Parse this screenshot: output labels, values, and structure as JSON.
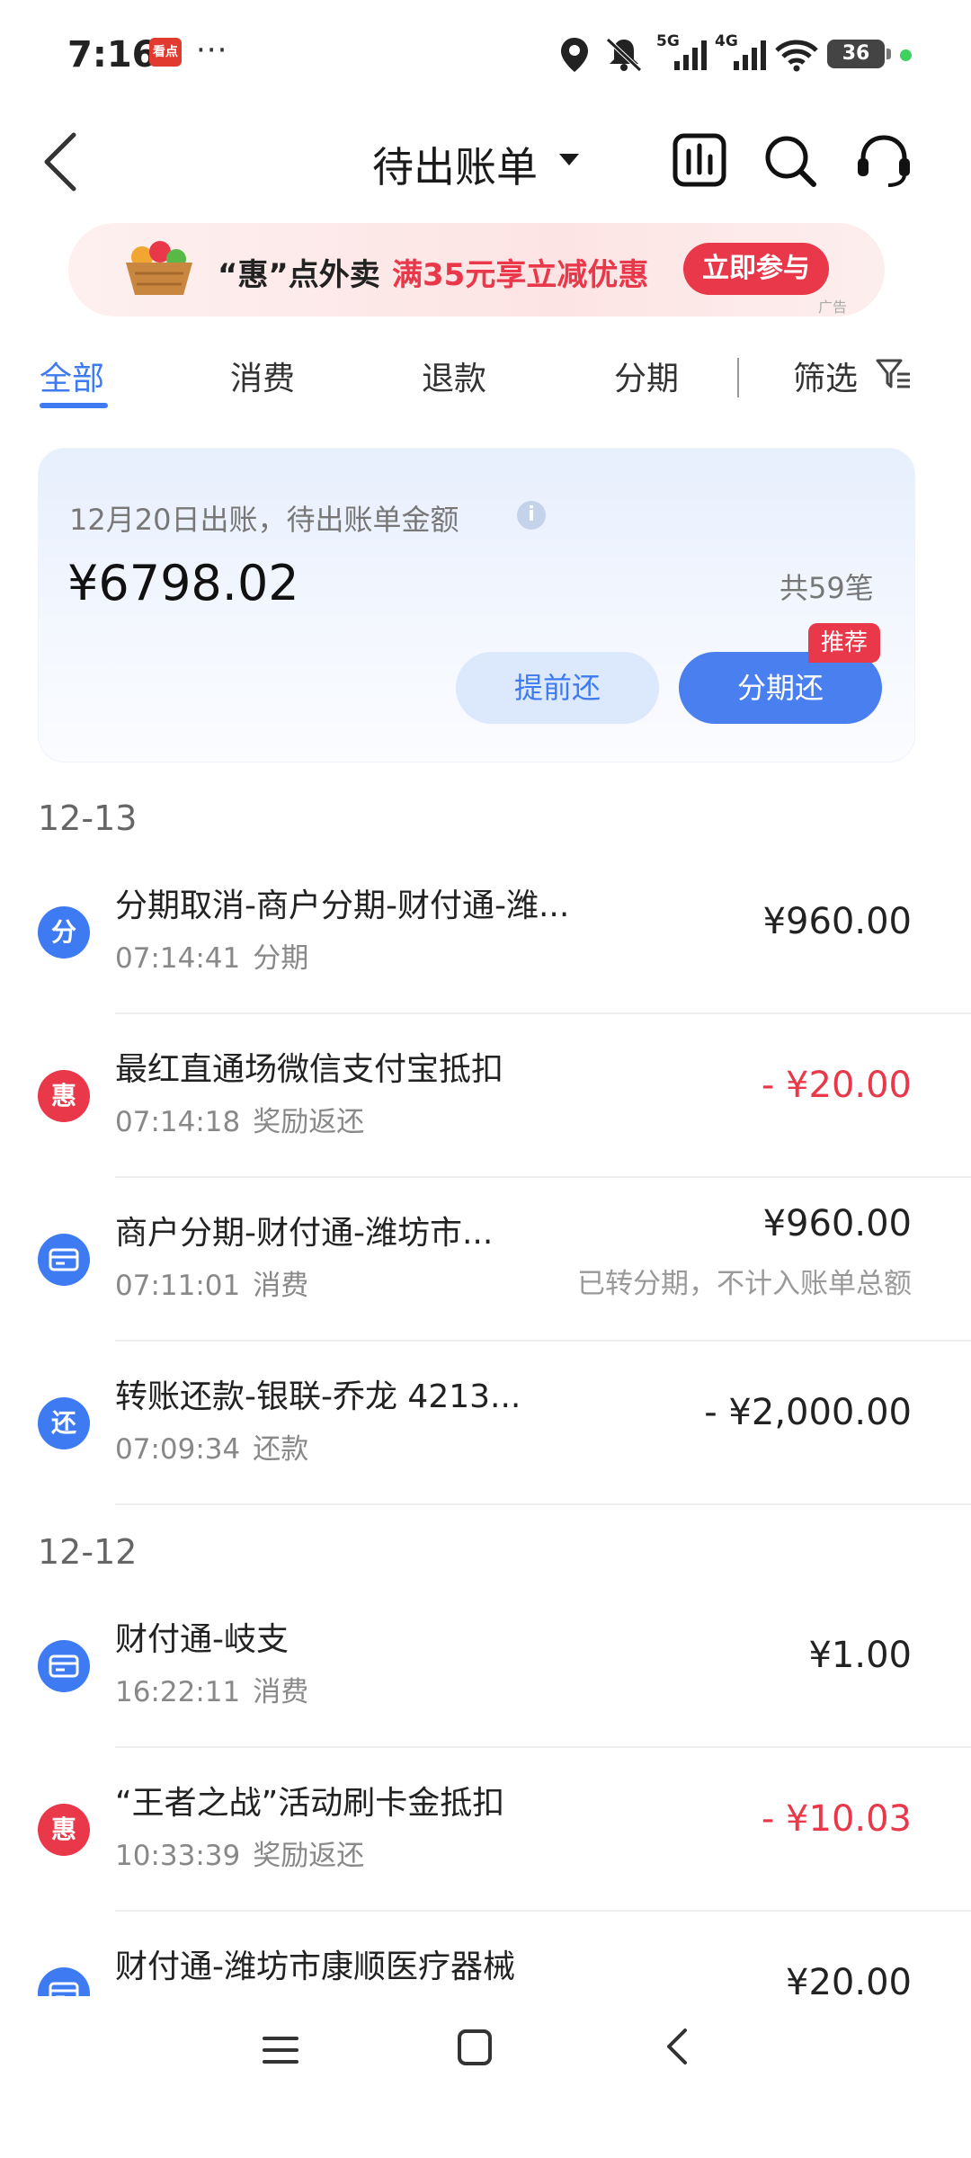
{
  "status_bar": {
    "time": "7:16",
    "app_badge": "看点",
    "more": "···",
    "net_a": "5G",
    "net_b": "4G",
    "battery": "36"
  },
  "header": {
    "title": "待出账单",
    "icons": [
      "back-icon",
      "bar-chart-icon",
      "search-icon",
      "headset-icon"
    ]
  },
  "ad": {
    "text_a": "“惠”点外卖",
    "text_b": "满35元享立减优惠",
    "button": "立即参与",
    "tag": "广告"
  },
  "tabs": [
    {
      "label": "全部",
      "active": true
    },
    {
      "label": "消费",
      "active": false
    },
    {
      "label": "退款",
      "active": false
    },
    {
      "label": "分期",
      "active": false
    }
  ],
  "filter": {
    "label": "筛选"
  },
  "summary": {
    "label": "12月20日出账，待出账单金额",
    "amount": "¥6798.02",
    "count": "共59笔",
    "prepay_button": "提前还",
    "installment_button": "分期还",
    "recommend_badge": "推荐"
  },
  "groups": [
    {
      "date": "12-13",
      "items": [
        {
          "icon_text": "分",
          "icon_color": "#3e7bf2",
          "title": "分期取消-商户分期-财付通-潍...",
          "time": "07:14:41",
          "type": "分期",
          "amount": "¥960.00",
          "amount_color": "#222222",
          "note": ""
        },
        {
          "icon_text": "惠",
          "icon_color": "#e8384a",
          "title": "最红直通场微信支付宝抵扣",
          "time": "07:14:18",
          "type": "奖励返还",
          "amount": "- ¥20.00",
          "amount_color": "#e8384a",
          "note": ""
        },
        {
          "icon_text": "card-icon",
          "icon_color": "#3e7bf2",
          "title": "商户分期-财付通-潍坊市...",
          "time": "07:11:01",
          "type": "消费",
          "amount": "¥960.00",
          "amount_color": "#222222",
          "note": "已转分期，不计入账单总额"
        },
        {
          "icon_text": "还",
          "icon_color": "#3e7bf2",
          "title": "转账还款-银联-乔龙 4213...",
          "time": "07:09:34",
          "type": "还款",
          "amount": "- ¥2,000.00",
          "amount_color": "#222222",
          "note": ""
        }
      ]
    },
    {
      "date": "12-12",
      "items": [
        {
          "icon_text": "card-icon",
          "icon_color": "#3e7bf2",
          "title": "财付通-岐支",
          "time": "16:22:11",
          "type": "消费",
          "amount": "¥1.00",
          "amount_color": "#222222",
          "note": ""
        },
        {
          "icon_text": "惠",
          "icon_color": "#e8384a",
          "title": "“王者之战”活动刷卡金抵扣",
          "time": "10:33:39",
          "type": "奖励返还",
          "amount": "- ¥10.03",
          "amount_color": "#e8384a",
          "note": ""
        },
        {
          "icon_text": "card-icon",
          "icon_color": "#3e7bf2",
          "title": "财付通-潍坊市康顺医疗器械",
          "time": "",
          "type": "",
          "amount": "¥20.00",
          "amount_color": "#222222",
          "note": ""
        }
      ]
    }
  ],
  "nav": {
    "icons": [
      "menu-icon",
      "home-icon",
      "back-icon"
    ]
  }
}
